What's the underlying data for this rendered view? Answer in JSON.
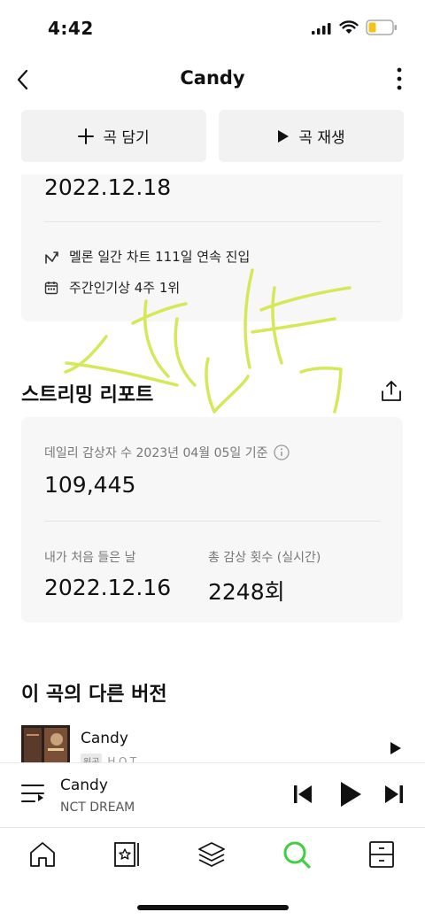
{
  "status_bar": {
    "time": "4:42"
  },
  "nav": {
    "title": "Candy"
  },
  "actions": {
    "add_label": "곡 담기",
    "play_label": "곡 재생"
  },
  "info": {
    "release_date": "2022.12.18",
    "chart_streak": "멜론 일간 차트 111일 연속 진입",
    "weekly_popular": "주간인기상 4주 1위"
  },
  "streaming_report": {
    "title": "스트리밍 리포트",
    "daily_label": "데일리 감상자 수 2023년 04월 05일 기준",
    "daily_value": "109,445",
    "first_listen_label": "내가 처음 들은 날",
    "first_listen_value": "2022.12.16",
    "total_plays_label": "총 감상 횟수 (실시간)",
    "total_plays_value": "2248회"
  },
  "other_versions": {
    "title": "이 곡의 다른 버전",
    "items": [
      {
        "title": "Candy",
        "badge": "원곡",
        "artist": "H.O.T."
      }
    ]
  },
  "mini_player": {
    "title": "Candy",
    "artist": "NCT DREAM"
  },
  "colors": {
    "accent": "#3fcf40",
    "card_bg": "#f7f7f7",
    "button_bg": "#f2f2f2",
    "scribble": "#d6e85a"
  },
  "tabs": [
    {
      "icon": "home-icon"
    },
    {
      "icon": "library-icon"
    },
    {
      "icon": "layers-icon"
    },
    {
      "icon": "search-icon",
      "active": true
    },
    {
      "icon": "drawer-icon"
    }
  ]
}
